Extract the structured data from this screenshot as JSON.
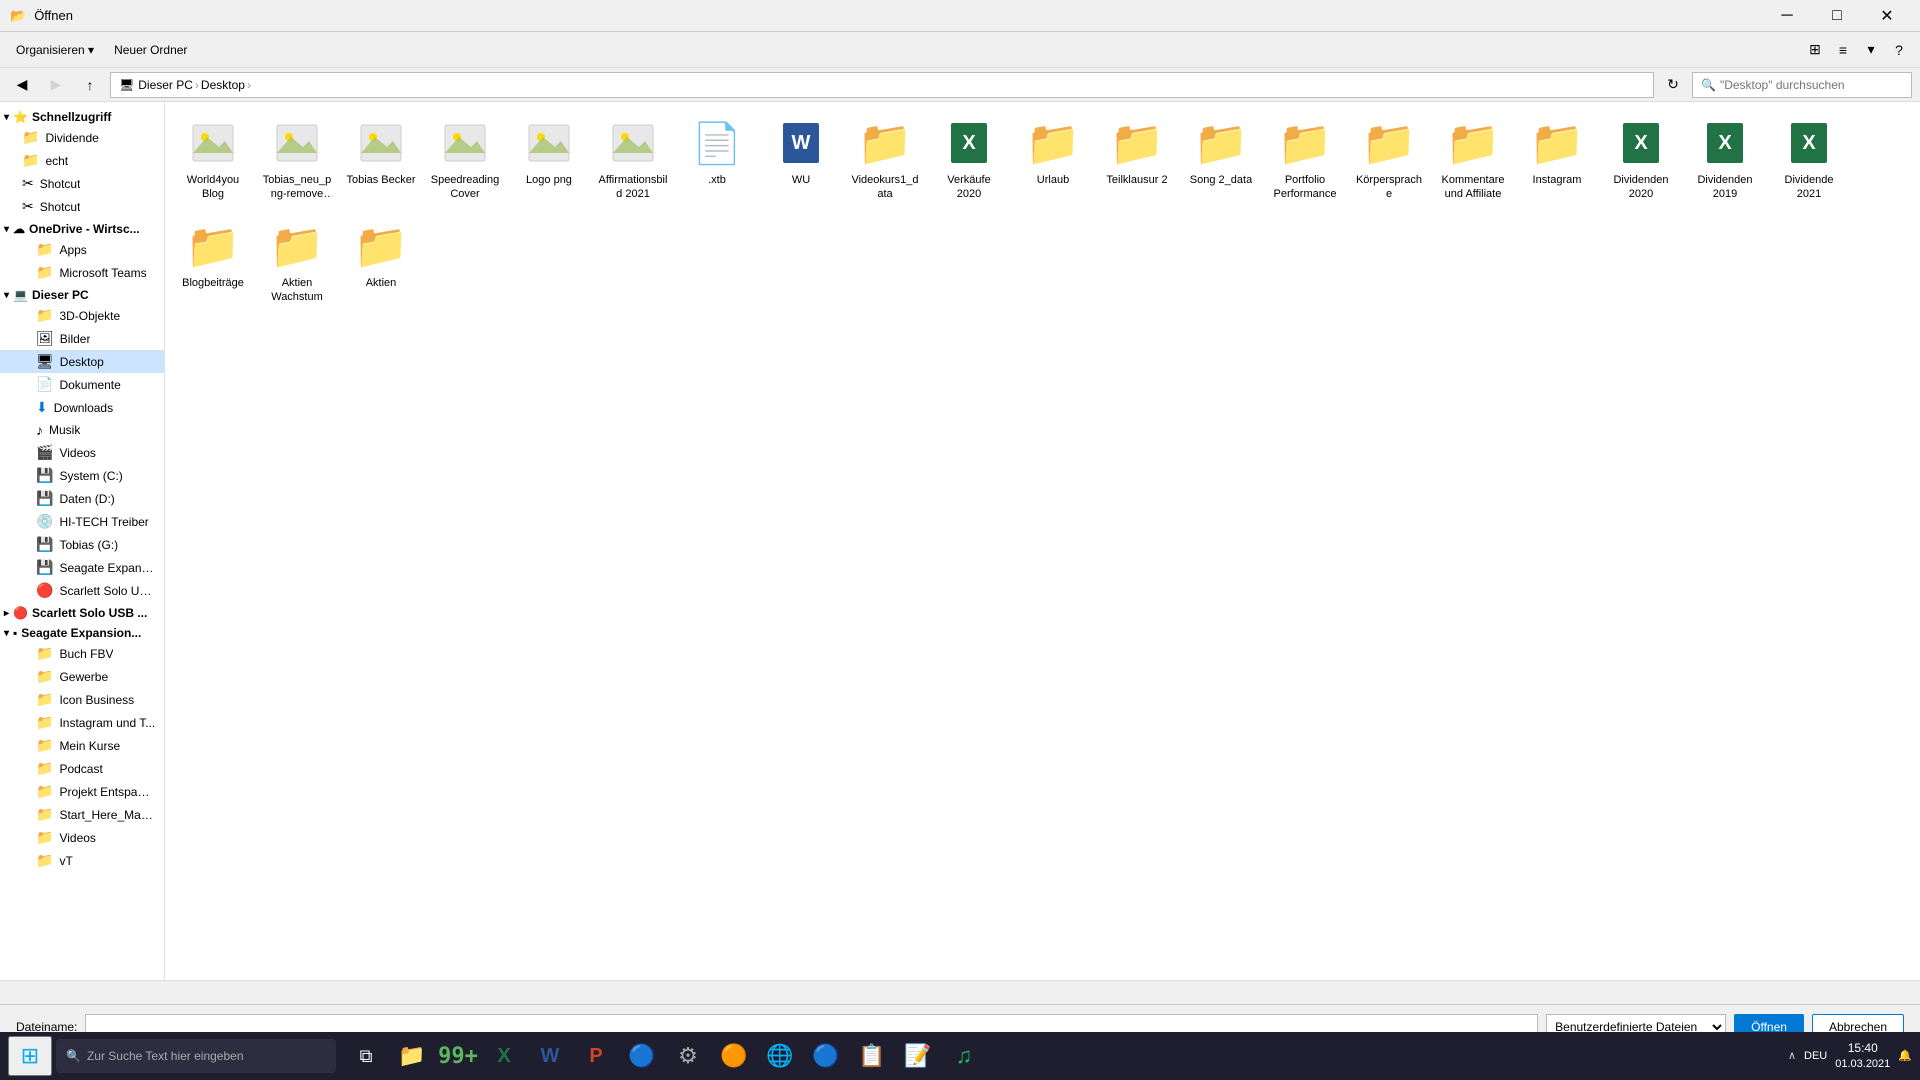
{
  "titlebar": {
    "title": "Öffnen",
    "close_label": "✕",
    "min_label": "─",
    "max_label": "□"
  },
  "toolbar": {
    "organize_label": "Organisieren ▾",
    "new_folder_label": "Neuer Ordner",
    "view_icons": [
      "⊞",
      "≡"
    ],
    "extra_icon": "?"
  },
  "addressbar": {
    "path": "Dieser PC › Desktop",
    "breadcrumbs": [
      "Dieser PC",
      "Desktop"
    ],
    "search_placeholder": "\"Desktop\" durchsuchen",
    "refresh": "↻",
    "up": "↑"
  },
  "sidebar": {
    "quick_access": {
      "label": "Schnellzugriff",
      "items": [
        {
          "name": "Dividende",
          "icon": "📁",
          "indent": 1
        },
        {
          "name": "echt",
          "icon": "📁",
          "indent": 1
        },
        {
          "name": "Shotcut",
          "icon": "📁",
          "indent": 1
        },
        {
          "name": "Shotcut",
          "icon": "📁",
          "indent": 1
        }
      ]
    },
    "onedrive": {
      "label": "OneDrive - Wirtsc...",
      "icon": "☁",
      "items": [
        {
          "name": "Apps",
          "icon": "📁",
          "indent": 2
        },
        {
          "name": "Microsoft Teams",
          "icon": "📁",
          "indent": 2
        }
      ]
    },
    "this_pc": {
      "label": "Dieser PC",
      "icon": "💻",
      "items": [
        {
          "name": "3D-Objekte",
          "icon": "📁",
          "indent": 2
        },
        {
          "name": "Bilder",
          "icon": "🖼",
          "indent": 2
        },
        {
          "name": "Desktop",
          "icon": "🖥",
          "indent": 2,
          "active": true
        },
        {
          "name": "Dokumente",
          "icon": "📄",
          "indent": 2
        },
        {
          "name": "Downloads",
          "icon": "⬇",
          "indent": 2
        },
        {
          "name": "Musik",
          "icon": "♪",
          "indent": 2
        },
        {
          "name": "Videos",
          "icon": "🎬",
          "indent": 2
        },
        {
          "name": "System (C:)",
          "icon": "💾",
          "indent": 2
        },
        {
          "name": "Daten (D:)",
          "icon": "💾",
          "indent": 2
        },
        {
          "name": "HI-TECH Treiber",
          "icon": "💿",
          "indent": 2
        },
        {
          "name": "Tobias (G:)",
          "icon": "💾",
          "indent": 2
        },
        {
          "name": "Seagate Expansi...",
          "icon": "💾",
          "indent": 2
        },
        {
          "name": "Scarlett Solo USB...",
          "icon": "🔴",
          "indent": 2
        }
      ]
    },
    "scarlett": {
      "label": "Scarlett Solo USB ...",
      "icon": "🔴"
    },
    "seagate": {
      "label": "Seagate Expansion...",
      "icon": "▪",
      "items": [
        {
          "name": "Buch FBV",
          "icon": "📁",
          "indent": 2
        },
        {
          "name": "Gewerbe",
          "icon": "📁",
          "indent": 2
        },
        {
          "name": "Icon Business",
          "icon": "📁",
          "indent": 2
        },
        {
          "name": "Instagram und T...",
          "icon": "📁",
          "indent": 2
        },
        {
          "name": "Mein Kurse",
          "icon": "📁",
          "indent": 2
        },
        {
          "name": "Podcast",
          "icon": "📁",
          "indent": 2
        },
        {
          "name": "Projekt Entspann...",
          "icon": "📁",
          "indent": 2
        },
        {
          "name": "Start_Here_Mac...",
          "icon": "📁",
          "indent": 2
        },
        {
          "name": "Videos",
          "icon": "📁",
          "indent": 2
        },
        {
          "name": "vT",
          "icon": "📁",
          "indent": 2
        }
      ]
    }
  },
  "files": [
    {
      "name": "World4you Blog",
      "type": "image",
      "icon": "🖼"
    },
    {
      "name": "Tobias_neu_png-remove bg-preview",
      "type": "image",
      "icon": "👤"
    },
    {
      "name": "Tobias Becker",
      "type": "image",
      "icon": "👤"
    },
    {
      "name": "Speedreading Cover",
      "type": "image",
      "icon": "🖼"
    },
    {
      "name": "Logo png",
      "type": "image",
      "icon": "📈"
    },
    {
      "name": "Affirmationsbild 2021",
      "type": "image",
      "icon": "🖼"
    },
    {
      "name": ".xtb",
      "type": "file",
      "icon": "📄"
    },
    {
      "name": "WU",
      "type": "word",
      "icon": "W"
    },
    {
      "name": "Videokurs1_data",
      "type": "folder",
      "icon": "📁"
    },
    {
      "name": "Verkäufe 2020",
      "type": "excel",
      "icon": "X"
    },
    {
      "name": "Urlaub",
      "type": "folder_img",
      "icon": "📁"
    },
    {
      "name": "Teilklausur 2",
      "type": "folder",
      "icon": "📁"
    },
    {
      "name": "Song 2_data",
      "type": "folder",
      "icon": "📁"
    },
    {
      "name": "Portfolio Performance",
      "type": "folder",
      "icon": "📁"
    },
    {
      "name": "Körpersprache",
      "type": "folder",
      "icon": "📁"
    },
    {
      "name": "Kommentare und Affiliate",
      "type": "folder",
      "icon": "📁"
    },
    {
      "name": "Instagram",
      "type": "folder",
      "icon": "📁"
    },
    {
      "name": "Dividenden 2020",
      "type": "excel",
      "icon": "X"
    },
    {
      "name": "Dividenden 2019",
      "type": "excel",
      "icon": "X"
    },
    {
      "name": "Dividende 2021",
      "type": "excel",
      "icon": "X"
    },
    {
      "name": "Blogbeiträge",
      "type": "folder",
      "icon": "📁"
    },
    {
      "name": "Aktien Wachstum",
      "type": "folder",
      "icon": "📁"
    },
    {
      "name": "Aktien",
      "type": "folder",
      "icon": "📁"
    }
  ],
  "dialog": {
    "filename_label": "Dateiname:",
    "filename_value": "",
    "filetype_label": "Benutzerdefinierte Dateien",
    "open_btn": "Öffnen",
    "cancel_btn": "Abbrechen"
  },
  "statusbar": {
    "text": ""
  },
  "taskbar": {
    "search_placeholder": "Zur Suche Text hier eingeben",
    "time": "15:40",
    "date": "01.03.2021",
    "language": "DEU",
    "apps": [
      {
        "name": "windows-start",
        "icon": "⊞",
        "color": "#00adef"
      },
      {
        "name": "search",
        "icon": "🔍"
      },
      {
        "name": "task-view",
        "icon": "⧉"
      },
      {
        "name": "file-explorer",
        "icon": "📁"
      },
      {
        "name": "app1",
        "icon": "🟩"
      },
      {
        "name": "excel",
        "icon": "X"
      },
      {
        "name": "word",
        "icon": "W"
      },
      {
        "name": "powerpoint",
        "icon": "P"
      },
      {
        "name": "app2",
        "icon": "🟦"
      },
      {
        "name": "app3",
        "icon": "⚙"
      },
      {
        "name": "app4",
        "icon": "🟠"
      },
      {
        "name": "chrome",
        "icon": "🌐"
      },
      {
        "name": "edge",
        "icon": "🔵"
      },
      {
        "name": "app5",
        "icon": "📋"
      },
      {
        "name": "app6",
        "icon": "🎵"
      },
      {
        "name": "spotify",
        "icon": "🎵"
      }
    ]
  }
}
